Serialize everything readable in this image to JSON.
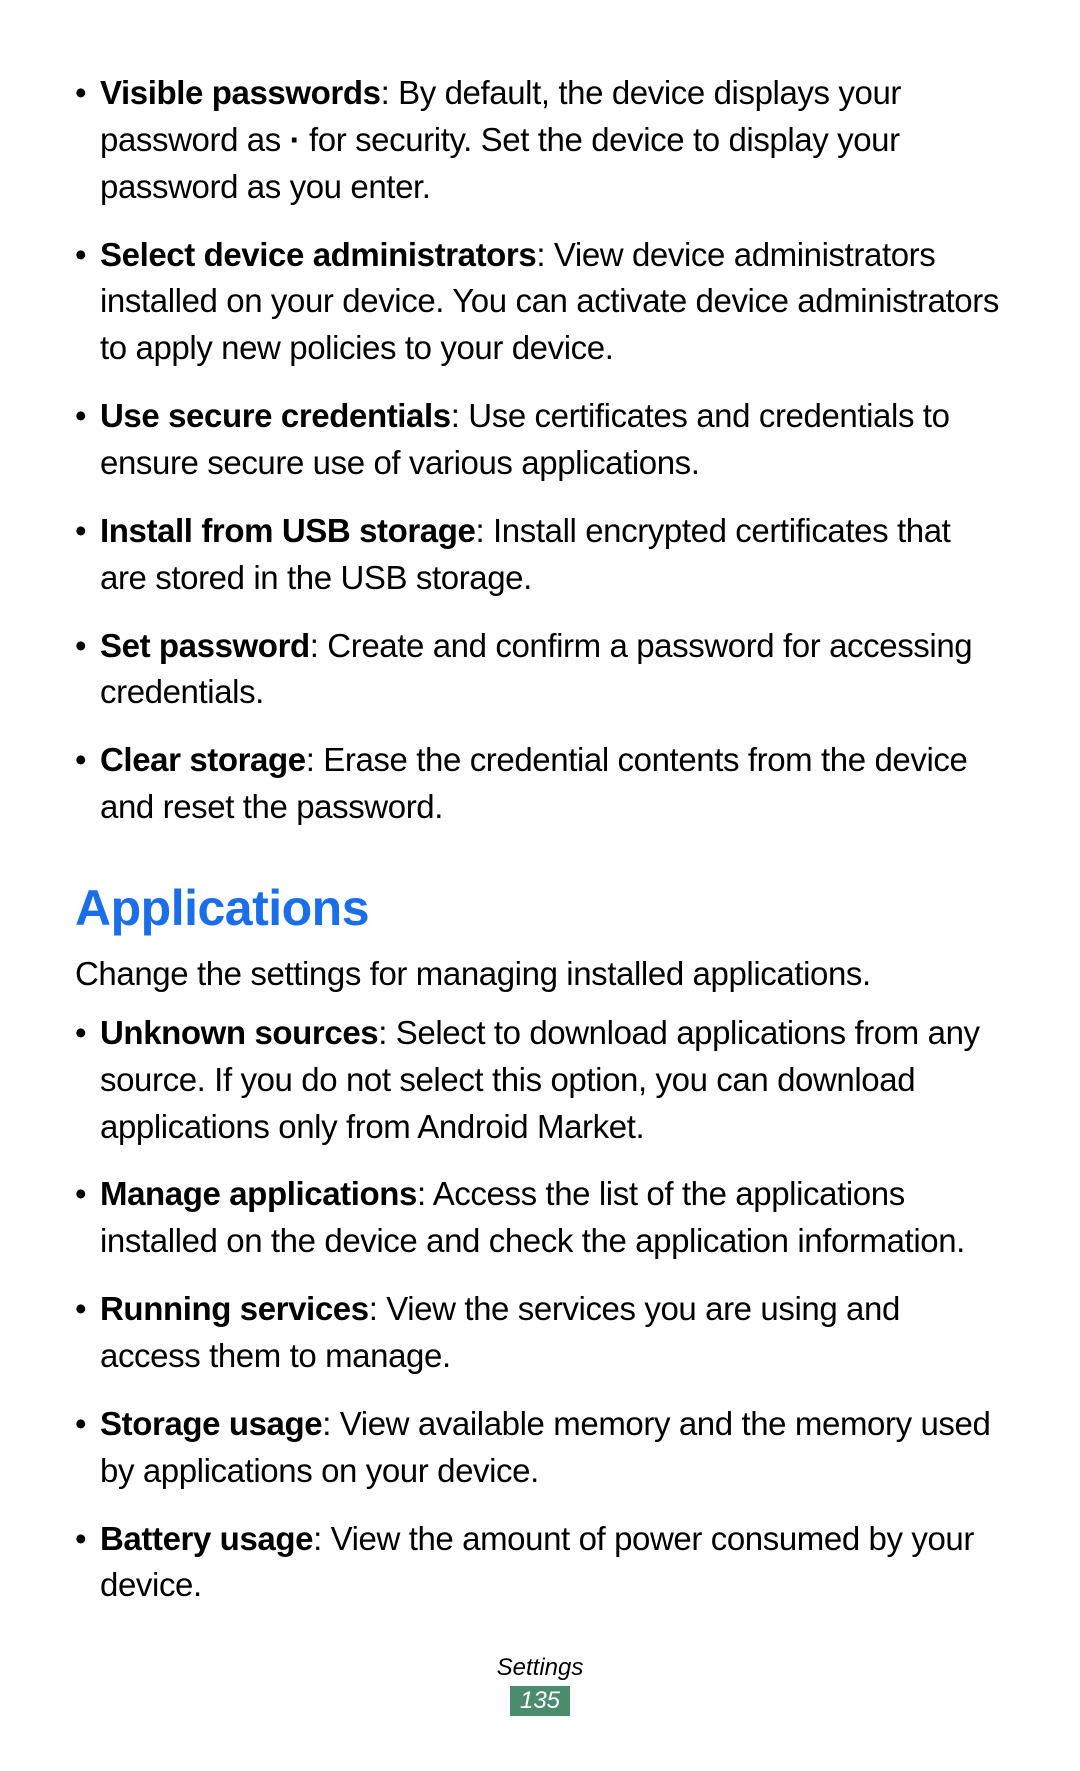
{
  "top_list": [
    {
      "title": "Visible passwords",
      "desc_pre": ": By default, the device displays your password as ",
      "mid": "·",
      "desc_post": " for security. Set the device to display your password as you enter."
    },
    {
      "title": "Select device administrators",
      "desc": ": View device administrators installed on your device. You can activate device administrators to apply new policies to your device."
    },
    {
      "title": "Use secure credentials",
      "desc": ": Use certificates and credentials to ensure secure use of various applications."
    },
    {
      "title": "Install from USB storage",
      "desc": ": Install encrypted certificates that are stored in the USB storage."
    },
    {
      "title": "Set password",
      "desc": ": Create and confirm a password for accessing credentials."
    },
    {
      "title": "Clear storage",
      "desc": ": Erase the credential contents from the device and reset the password."
    }
  ],
  "section": {
    "heading": "Applications",
    "intro": "Change the settings for managing installed applications."
  },
  "apps_list": [
    {
      "title": "Unknown sources",
      "desc": ": Select to download applications from any source. If you do not select this option, you can download applications only from Android Market."
    },
    {
      "title": "Manage applications",
      "desc": ": Access the list of the applications installed on the device and check the application information."
    },
    {
      "title": "Running services",
      "desc": ": View the services you are using and access them to manage."
    },
    {
      "title": "Storage usage",
      "desc": ": View available memory and the memory used by applications on your device."
    },
    {
      "title": "Battery usage",
      "desc": ": View the amount of power consumed by your device."
    }
  ],
  "footer": {
    "category": "Settings",
    "page": "135"
  }
}
